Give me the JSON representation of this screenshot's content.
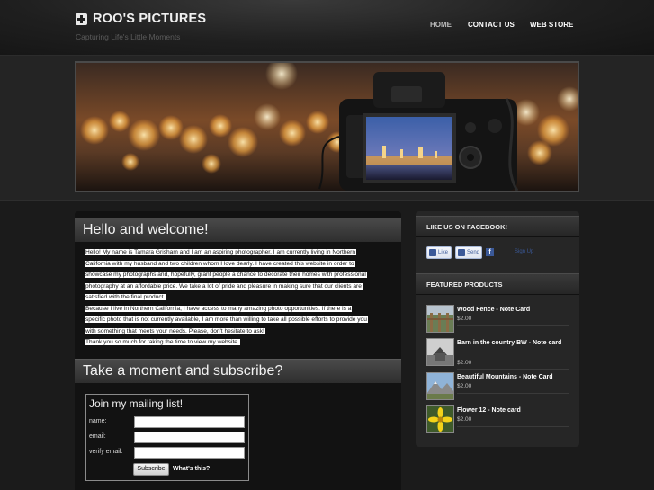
{
  "header": {
    "site_title": "ROO'S PICTURES",
    "tagline": "Capturing Life's Little Moments",
    "nav": [
      {
        "label": "HOME"
      },
      {
        "label": "CONTACT US"
      },
      {
        "label": "WEB STORE"
      }
    ]
  },
  "main": {
    "welcome_title": "Hello and welcome!",
    "intro_lines": [
      "Hello! My name is Tamara Grisham and I am an aspiring photographer. I am currently living in Northern",
      "California with my husband and two children whom I love dearly. I have created this website in order to",
      "showcase my photographs and, hopefully, grant people a chance to decorate their homes with professional",
      "photography at an affordable price. We take a lot of pride and pleasure in making sure that our clients are",
      "satisfied with the final product.",
      "Because I live in Northern California, I have access to many amazing photo opportunities. If there is a",
      "specific photo that is not currently available, I am more than willing to take all possible efforts to provide you",
      "with something that meets your needs. Please, don't hesitate to ask!",
      "Thank you so much for taking the time to view my website."
    ],
    "subscribe_title": "Take a moment and subscribe?",
    "mailing": {
      "title": "Join my mailing list!",
      "name_label": "name:",
      "email_label": "email:",
      "verify_label": "verify email:",
      "button": "Subscribe",
      "whats_this": "What's this?"
    }
  },
  "sidebar": {
    "facebook": {
      "title": "LIKE US ON FACEBOOK!",
      "like": "Like",
      "send": "Send",
      "text": "Sign Up"
    },
    "featured": {
      "title": "FEATURED PRODUCTS",
      "products": [
        {
          "name": "Wood Fence - Note Card",
          "price": "$2.00"
        },
        {
          "name": "Barn in the country BW - Note card",
          "price": "$2.00"
        },
        {
          "name": "Beautiful Mountains - Note Card",
          "price": "$2.00"
        },
        {
          "name": "Flower 12 - Note card",
          "price": "$2.00"
        }
      ]
    }
  }
}
